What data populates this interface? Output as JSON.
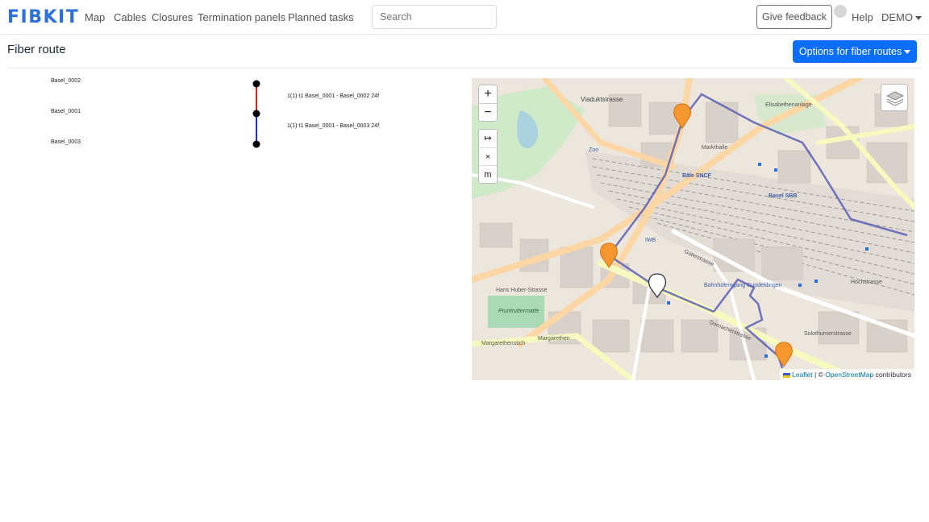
{
  "app": {
    "brand": "FIBKIT",
    "nav": [
      {
        "label": "Map"
      },
      {
        "label": "Cables"
      },
      {
        "label": "Closures"
      },
      {
        "label": "Termination panels"
      },
      {
        "label": "Planned tasks"
      }
    ],
    "search_placeholder": "Search",
    "feedback_label": "Give feedback",
    "help_label": "Help",
    "user_label": "DEMO"
  },
  "page": {
    "title": "Fiber route",
    "options_label": "Options for fiber routes"
  },
  "route": {
    "nodes": [
      {
        "label": "Basel_0002"
      },
      {
        "label": "Basel_0001"
      },
      {
        "label": "Basel_0003"
      }
    ],
    "cables": [
      {
        "label": "1(1) t1 Basel_0001 - Basel_0002 24f",
        "color": "#e0201a"
      },
      {
        "label": "1(1) t1 Basel_0001 - Basel_0003 24f",
        "color": "#1a2bd8"
      }
    ]
  },
  "map": {
    "zoom_in": "+",
    "zoom_out": "−",
    "tools": [
      "↦",
      "×",
      "m"
    ],
    "attribution": {
      "leaflet": "Leaflet",
      "sep": " | © ",
      "osm": "OpenStreetMap",
      "suffix": " contributors"
    },
    "labels": {
      "viaduktstrasse": "Viaduktstrasse",
      "elisabethenanlage": "Elisabethenanlage",
      "markthalle": "Markthalle",
      "bale_sncf": "Bâle SNCF",
      "basel_sbb": "Basel SBB",
      "margarethen": "Margarethen",
      "dornacherstrasse": "Dornacherstrasse",
      "solothurnerstrasse": "Solothurnerstrasse",
      "hans_huber": "Hans Huber-Strasse",
      "gundeldingen": "Bahnhofeingang Gundeldingen",
      "gueterstrasse": "Güterstrasse",
      "hochstrasse": "Hochstrasse",
      "zoo": "Zoo",
      "pruntruttermatte": "Pruntruttermatte",
      "margarethenstich": "Margarethenstich",
      "iwb": "IWB"
    }
  }
}
